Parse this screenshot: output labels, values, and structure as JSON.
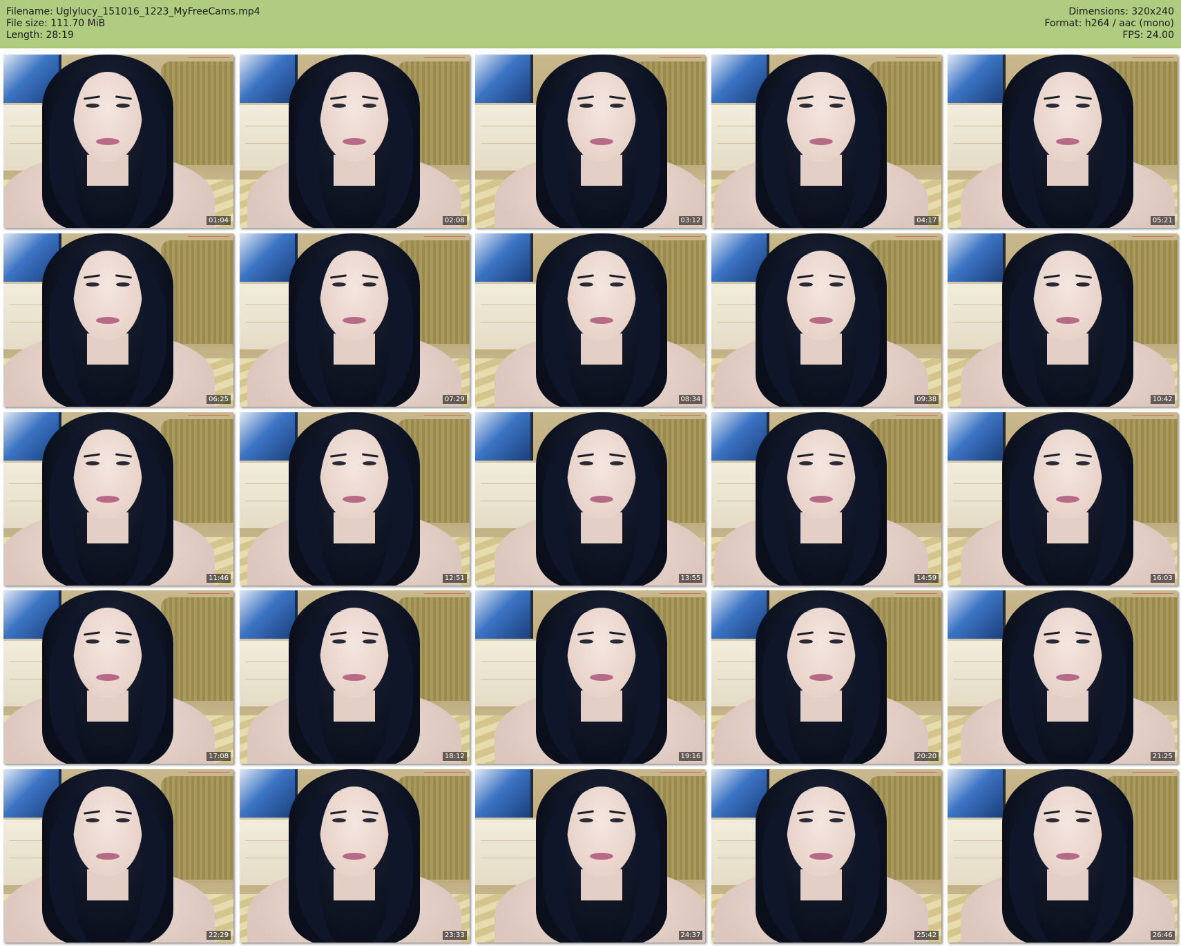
{
  "header": {
    "filename_line": "Filename: Uglylucy_151016_1223_MyFreeCams.mp4",
    "filesize_line": "File size: 111.70 MiB",
    "length_line": "Length: 28:19",
    "dimensions_line": "Dimensions: 320x240",
    "format_line": "Format: h264 / aac (mono)",
    "fps_line": "FPS: 24.00",
    "background_color": "#b0cc80"
  },
  "thumbnails": [
    {
      "timestamp": "01:04"
    },
    {
      "timestamp": "02:08"
    },
    {
      "timestamp": "03:12"
    },
    {
      "timestamp": "04:17"
    },
    {
      "timestamp": "05:21"
    },
    {
      "timestamp": "06:25"
    },
    {
      "timestamp": "07:29"
    },
    {
      "timestamp": "08:34"
    },
    {
      "timestamp": "09:38"
    },
    {
      "timestamp": "10:42"
    },
    {
      "timestamp": "11:46"
    },
    {
      "timestamp": "12:51"
    },
    {
      "timestamp": "13:55"
    },
    {
      "timestamp": "14:59"
    },
    {
      "timestamp": "16:03"
    },
    {
      "timestamp": "17:08"
    },
    {
      "timestamp": "18:12"
    },
    {
      "timestamp": "19:16"
    },
    {
      "timestamp": "20:20"
    },
    {
      "timestamp": "21:25"
    },
    {
      "timestamp": "22:29"
    },
    {
      "timestamp": "23:33"
    },
    {
      "timestamp": "24:37"
    },
    {
      "timestamp": "25:42"
    },
    {
      "timestamp": "26:46"
    }
  ]
}
